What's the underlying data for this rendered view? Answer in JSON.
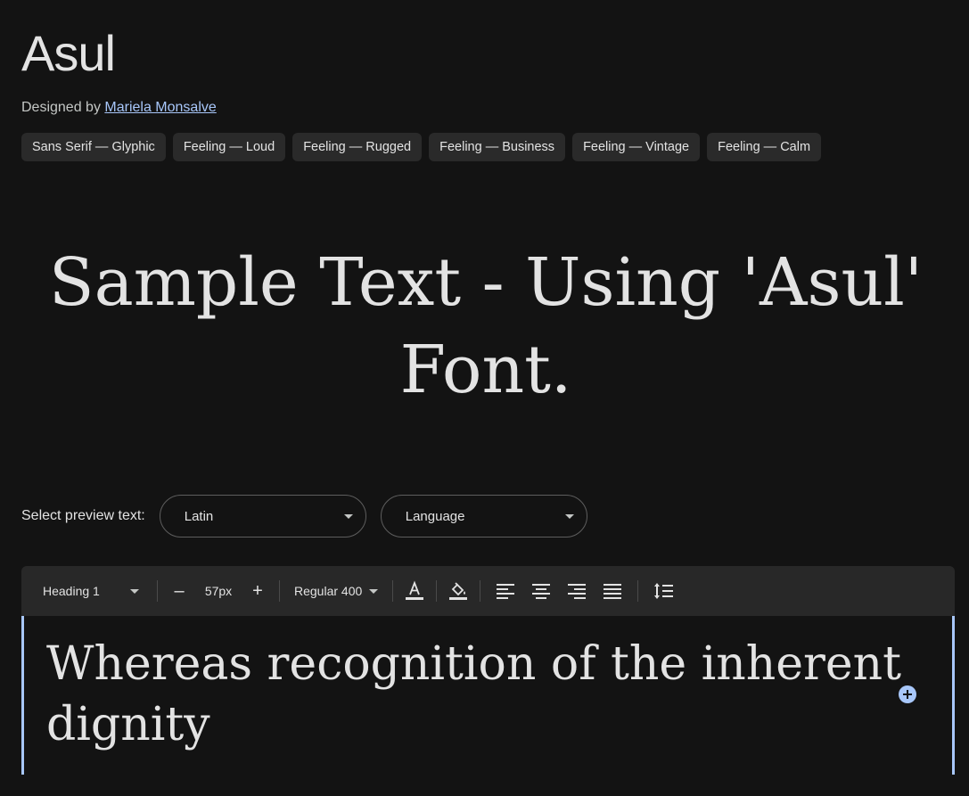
{
  "font": {
    "name": "Asul",
    "designed_by_prefix": "Designed by ",
    "designer": "Mariela Monsalve"
  },
  "tags": [
    "Sans Serif — Glyphic",
    "Feeling — Loud",
    "Feeling — Rugged",
    "Feeling — Business",
    "Feeling — Vintage",
    "Feeling — Calm"
  ],
  "hero": {
    "text": "Sample Text - Using 'Asul' Font."
  },
  "preview": {
    "label": "Select preview text:",
    "script_select": "Latin",
    "language_select": "Language"
  },
  "toolbar": {
    "style_select": "Heading 1",
    "decrease": "–",
    "size": "57px",
    "increase": "+",
    "weight_select": "Regular 400"
  },
  "editor": {
    "text": "Whereas recognition of the inherent dignity"
  },
  "colors": {
    "background": "#131313",
    "accent": "#a8c7fa",
    "chip": "#2a2a2a",
    "toolbar": "#282828"
  }
}
